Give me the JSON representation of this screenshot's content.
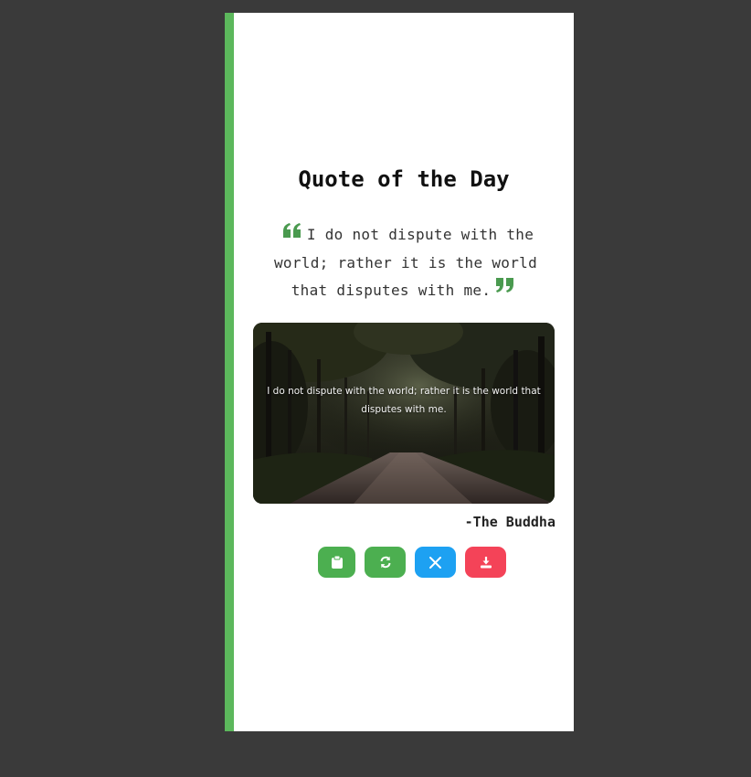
{
  "card": {
    "title": "Quote of the Day",
    "quote_text": "I do not dispute with the world; rather it is the world that disputes with me.",
    "image_caption": "I do not dispute with the world; rather it is the world that disputes with me.",
    "author": "-The Buddha"
  },
  "buttons": [
    {
      "name": "copy-button",
      "icon": "clipboard-icon",
      "color": "#4caf50"
    },
    {
      "name": "new-quote-button",
      "icon": "refresh-icon",
      "color": "#4caf50"
    },
    {
      "name": "tweet-button",
      "icon": "x-logo-icon",
      "color": "#1da1f2"
    },
    {
      "name": "download-button",
      "icon": "download-icon",
      "color": "#f44358"
    }
  ],
  "colors": {
    "accent": "#5cb85c",
    "quote_marks": "#4a9a4f",
    "page_background": "#3a3a3a",
    "card_background": "#ffffff"
  }
}
